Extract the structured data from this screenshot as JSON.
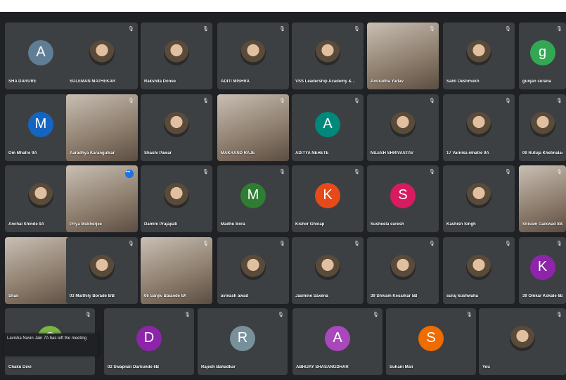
{
  "participants": [
    {
      "name": "SHA DARURE",
      "initial": "A",
      "color": "#5f7d95"
    },
    {
      "name": "SULEMAN MATHEKAR",
      "photo": true
    },
    {
      "name": "Rakshita Donee",
      "photo": true
    },
    {
      "name": "ADITI MISHRA",
      "photo": true
    },
    {
      "name": "VSS Leadership Academy &...",
      "photo": true
    },
    {
      "name": "Anuradha Yadav",
      "video": true
    },
    {
      "name": "Sahil Deshmukh",
      "photo": true
    },
    {
      "name": "gunjan surana",
      "initial": "g",
      "color": "#33a853"
    },
    {
      "name": "Om Mhatre 9A",
      "initial": "M",
      "color": "#1565c0"
    },
    {
      "name": "Aaradhya Karangulkar",
      "video": true
    },
    {
      "name": "Shashi Pawar",
      "photo": true
    },
    {
      "name": "MAKRAND RAJE",
      "video": true
    },
    {
      "name": "ADITYA NEHETE",
      "initial": "A",
      "color": "#00897b"
    },
    {
      "name": "NILESH SHRIVASTAV",
      "photo": true
    },
    {
      "name": "17 Varnika mhatre 9A",
      "photo": true
    },
    {
      "name": "09 Rutuja Khetmalas",
      "photo": true
    },
    {
      "name": "Anchal Shinde 9A",
      "photo": true
    },
    {
      "name": "Priya Mukherjee",
      "video": true,
      "speaking": true
    },
    {
      "name": "Damini Prajapati",
      "photo": true
    },
    {
      "name": "Madhu Bora",
      "initial": "M",
      "color": "#2e7d32"
    },
    {
      "name": "Kishor Gholap",
      "initial": "K",
      "color": "#e64a19"
    },
    {
      "name": "Susheela suresh",
      "initial": "S",
      "color": "#d81b60"
    },
    {
      "name": "Kashish Singh",
      "photo": true
    },
    {
      "name": "Shivam Gaikwad 8B",
      "video": true
    },
    {
      "name": "Shan",
      "video": true
    },
    {
      "name": "03 Maithily Borade 8/B",
      "photo": true
    },
    {
      "name": "06 Sanjiv Balande 8A",
      "video": true
    },
    {
      "name": "avinash awad",
      "photo": true
    },
    {
      "name": "Jasmine Saxena",
      "photo": true
    },
    {
      "name": "39 Shivam Kesarkar 5B",
      "photo": true
    },
    {
      "name": "suraj kushwaha",
      "photo": true
    },
    {
      "name": "39 Omkar Kokale 6B",
      "initial": "K",
      "color": "#8e24aa"
    },
    {
      "name": "Chaku Devi",
      "initial": "C",
      "color": "#7cb342"
    },
    {
      "name": "02 Swapnali Darkunde 6B",
      "initial": "D",
      "color": "#8e24aa"
    },
    {
      "name": "Rajesh Bahadkar",
      "initial": "R",
      "color": "#78909c"
    },
    {
      "name": "ABHIJAY SHASANGDHAR",
      "initial": "A",
      "color": "#ab47bc"
    },
    {
      "name": "Suhani Mali",
      "initial": "S",
      "color": "#ef6c00"
    },
    {
      "name": "You",
      "photo": true
    }
  ],
  "toast": "Lavisha Navin Jain 7A has left the meeting"
}
